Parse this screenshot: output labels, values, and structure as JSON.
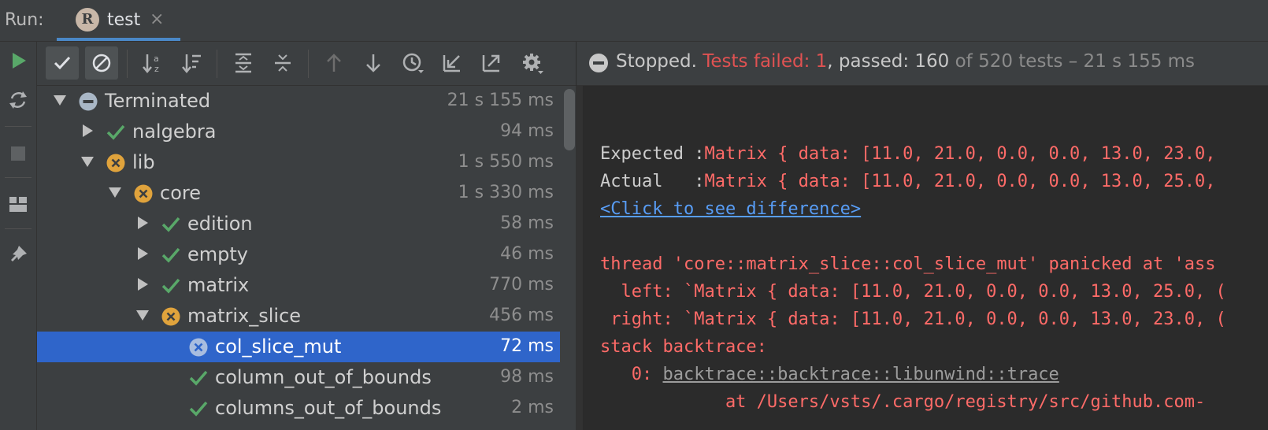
{
  "run_bar": {
    "label": "Run:",
    "tab": {
      "title": "test",
      "icon": "rust-logo-icon",
      "logo_letter": "R",
      "close": "×"
    }
  },
  "left_strip": {
    "icons": [
      "run-icon",
      "rerun-failed-icon",
      "stop-icon",
      "layout-icon",
      "pin-icon"
    ]
  },
  "tree_toolbar": {
    "buttons": [
      "show-passed-icon",
      "show-ignored-icon",
      "sort-alphabetically-icon",
      "sort-by-duration-icon",
      "expand-all-icon",
      "collapse-all-icon",
      "previous-failed-icon",
      "next-failed-icon",
      "test-history-icon",
      "import-tests-icon",
      "export-tests-icon",
      "settings-icon"
    ]
  },
  "status": {
    "state": "Stopped.",
    "failed_text": "Tests failed: 1",
    "sep": ",",
    "passed_text": "passed: 160",
    "total_text": "of 520 tests – 21 s 155 ms"
  },
  "tree": [
    {
      "label": "Terminated",
      "time": "21 s 155 ms",
      "status": "terminated",
      "expanded": true
    },
    {
      "label": "nalgebra",
      "time": "94 ms",
      "status": "passed",
      "expanded": false
    },
    {
      "label": "lib",
      "time": "1 s 550 ms",
      "status": "failed",
      "expanded": true
    },
    {
      "label": "core",
      "time": "1 s 330 ms",
      "status": "failed",
      "expanded": true
    },
    {
      "label": "edition",
      "time": "58 ms",
      "status": "passed",
      "expanded": false
    },
    {
      "label": "empty",
      "time": "46 ms",
      "status": "passed",
      "expanded": false
    },
    {
      "label": "matrix",
      "time": "770 ms",
      "status": "passed",
      "expanded": false
    },
    {
      "label": "matrix_slice",
      "time": "456 ms",
      "status": "failed",
      "expanded": true
    },
    {
      "label": "col_slice_mut",
      "time": "72 ms",
      "status": "failed",
      "selected": true
    },
    {
      "label": "column_out_of_bounds",
      "time": "98 ms",
      "status": "passed"
    },
    {
      "label": "columns_out_of_bounds",
      "time": "2 ms",
      "status": "passed"
    }
  ],
  "console": {
    "expected_label": "Expected :",
    "expected_value": "Matrix { data: [11.0, 21.0, 0.0, 0.0, 13.0, 23.0,",
    "actual_label": "Actual   :",
    "actual_value": "Matrix { data: [11.0, 21.0, 0.0, 0.0, 13.0, 25.0,",
    "diff_link": "<Click to see difference>",
    "panic_line": "thread 'core::matrix_slice::col_slice_mut' panicked at 'ass",
    "left_line": "  left: `Matrix { data: [11.0, 21.0, 0.0, 0.0, 13.0, 25.0, (",
    "right_line": " right: `Matrix { data: [11.0, 21.0, 0.0, 0.0, 13.0, 23.0, (",
    "backtrace_header": "stack backtrace:",
    "frame_index": "   0: ",
    "frame_fn": "backtrace::backtrace::libunwind::trace",
    "frame_at": "            at /Users/vsts/.cargo/registry/src/github.com-"
  },
  "colors": {
    "accent": "#4a88c7",
    "selection": "#2f65ca",
    "passed": "#59a869",
    "failed": "#e0a33c",
    "error_text": "#ff6b68",
    "link": "#589df6"
  }
}
